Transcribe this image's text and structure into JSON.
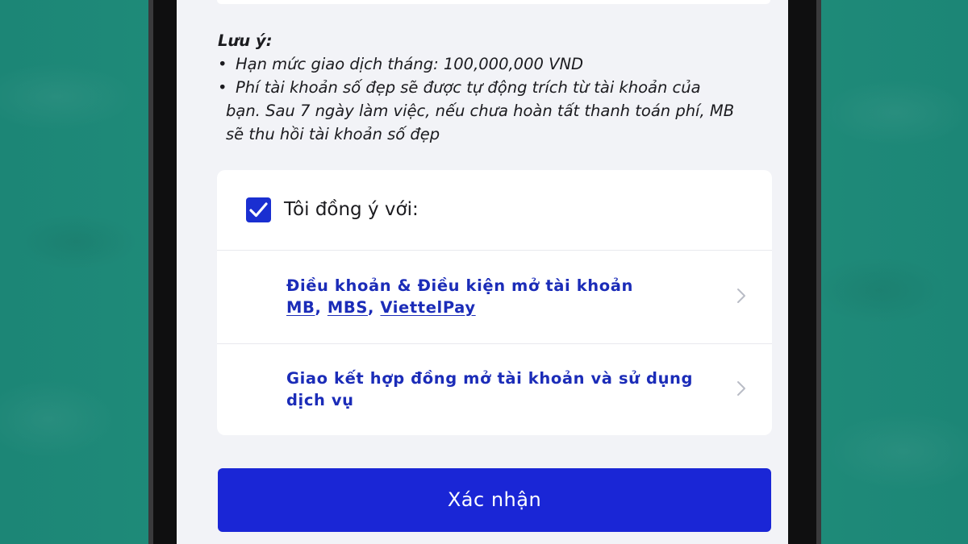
{
  "note": {
    "title": "Lưu ý:",
    "items": [
      {
        "line1": "Hạn mức giao dịch tháng: 100,000,000 VND"
      },
      {
        "line1": "Phí tài khoản số đẹp sẽ được tự động trích từ tài khoản của",
        "line2": "bạn. Sau 7 ngày làm việc, nếu chưa hoàn tất thanh toán phí, MB",
        "line3": "sẽ thu hồi tài khoản số đẹp"
      }
    ]
  },
  "agreement": {
    "checked": true,
    "label": "Tôi đồng ý với:",
    "links": [
      {
        "line1": "Điều khoản & Điều kiện mở tài khoản",
        "l2a": "MB",
        "l2b": "MBS",
        "l2c": "ViettelPay"
      },
      {
        "line1": "Giao kết hợp đồng mở tài khoản và sử dụng",
        "line2": "dịch vụ"
      }
    ]
  },
  "confirm_label": "Xác nhận",
  "colors": {
    "background": "#1f8f7f",
    "accent": "#1a26d6",
    "link": "#1b2cb8"
  },
  "icons": [
    "checkmark-icon",
    "chevron-right-icon"
  ]
}
